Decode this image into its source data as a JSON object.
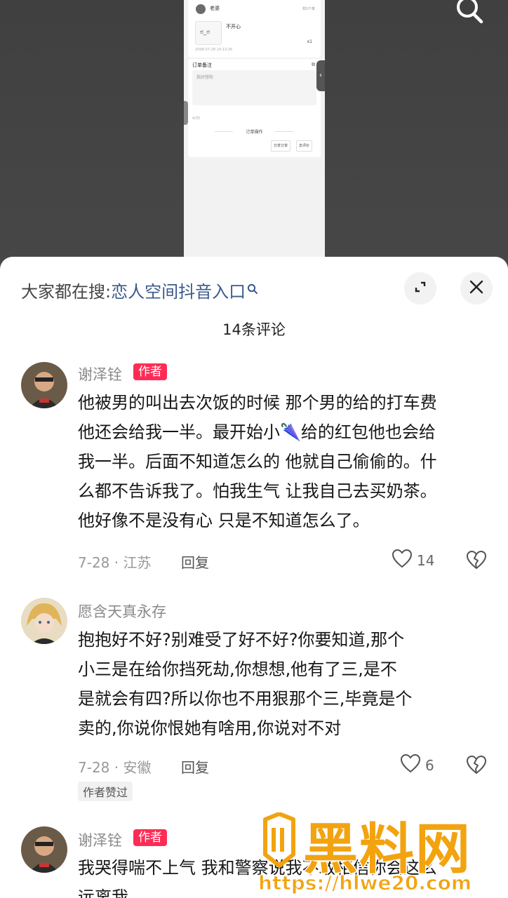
{
  "video": {
    "order": {
      "shop_name": "老婆",
      "count_label": "共1个单",
      "product_title": "不开心",
      "product_thumb_text": "ಠ_ಠ",
      "quantity": "x1",
      "order_time": "2008-07-28 14:13:26",
      "note_title": "订单备注",
      "note_text": "我好想你",
      "note_length": "4/35",
      "operations_title": "订单操作",
      "button_1": "分享订单",
      "button_2": "去评价"
    }
  },
  "sheet": {
    "hot_search_prefix": "大家都在搜:",
    "hot_search_link": "恋人空间抖音入口",
    "comment_count": "14条评论"
  },
  "comments": [
    {
      "name": "谢泽铨",
      "badge": "作者",
      "lines": [
        "他被男的叫出去次饭的时候 那个男的给的打车费",
        "他还会给我一半。最开始小🌂给的红包他也会给",
        "我一半。后面不知道怎么的 他就自己偷偷的。什",
        "么都不告诉我了。怕我生气 让我自己去买奶茶。",
        "他好像不是没有心 只是不知道怎么了。"
      ],
      "date_location": "7-28 · 江苏",
      "reply": "回复",
      "likes": "14"
    },
    {
      "name": "愿含天真永存",
      "lines": [
        "抱抱好不好?别难受了好不好?你要知道,那个",
        "小三是在给你挡死劫,你想想,他有了三,是不",
        "是就会有四?所以你也不用狠那个三,毕竟是个",
        "卖的,你说你恨她有啥用,你说对不对"
      ],
      "date_location": "7-28 · 安徽",
      "reply": "回复",
      "likes": "6",
      "author_liked": "作者赞过"
    },
    {
      "name": "谢泽铨",
      "badge": "作者",
      "lines": [
        "我哭得喘不上气 我和警察说我不敢相信你会这么",
        "远离我"
      ]
    }
  ],
  "watermark": {
    "title": "黑料网",
    "url": "https://hlwe20.com"
  },
  "colors": {
    "accent": "#fe2c55",
    "link": "#3a5a8c",
    "watermark": "#f2a30f"
  }
}
